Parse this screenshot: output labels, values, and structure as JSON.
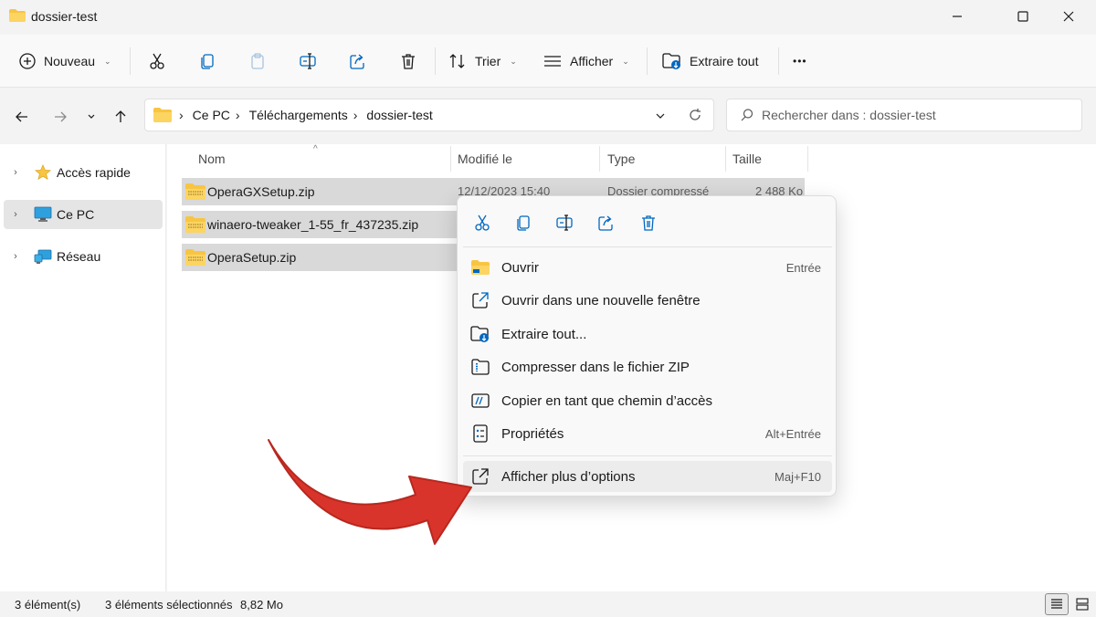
{
  "window": {
    "title": "dossier-test"
  },
  "toolbar": {
    "new_label": "Nouveau",
    "sort_label": "Trier",
    "view_label": "Afficher",
    "extract_label": "Extraire tout",
    "more_label": "•••"
  },
  "address": {
    "crumbs": [
      "Ce PC",
      "Téléchargements",
      "dossier-test"
    ],
    "search_placeholder": "Rechercher dans : dossier-test"
  },
  "nav": {
    "items": [
      {
        "label": "Accès rapide",
        "icon": "star-icon"
      },
      {
        "label": "Ce PC",
        "icon": "computer-icon",
        "selected": true
      },
      {
        "label": "Réseau",
        "icon": "network-icon"
      }
    ]
  },
  "columns": {
    "name": "Nom",
    "modified": "Modifié le",
    "type": "Type",
    "size": "Taille"
  },
  "files": [
    {
      "name": "OperaGXSetup.zip",
      "modified": "12/12/2023 15:40",
      "type": "Dossier compressé",
      "size": "2 488 Ko"
    },
    {
      "name": "winaero-tweaker_1-55_fr_437235.zip"
    },
    {
      "name": "OperaSetup.zip"
    }
  ],
  "context_menu": {
    "items": [
      {
        "label": "Ouvrir",
        "shortcut": "Entrée",
        "icon": "folder-open-icon"
      },
      {
        "label": "Ouvrir dans une nouvelle fenêtre",
        "shortcut": "",
        "icon": "open-new-window-icon"
      },
      {
        "label": "Extraire tout...",
        "shortcut": "",
        "icon": "extract-icon"
      },
      {
        "label": "Compresser dans le fichier ZIP",
        "shortcut": "",
        "icon": "zip-icon"
      },
      {
        "label": "Copier en tant que chemin d’accès",
        "shortcut": "",
        "icon": "copy-path-icon"
      },
      {
        "label": "Propriétés",
        "shortcut": "Alt+Entrée",
        "icon": "properties-icon"
      }
    ],
    "more": {
      "label": "Afficher plus d’options",
      "shortcut": "Maj+F10",
      "icon": "more-options-icon"
    }
  },
  "status": {
    "count": "3 élément(s)",
    "selected": "3 éléments sélectionnés",
    "size": "8,82 Mo"
  },
  "colors": {
    "accent": "#0067c0",
    "arrow": "#d9342b",
    "folder": "#f8c542",
    "selection": "#d9d9d9"
  }
}
